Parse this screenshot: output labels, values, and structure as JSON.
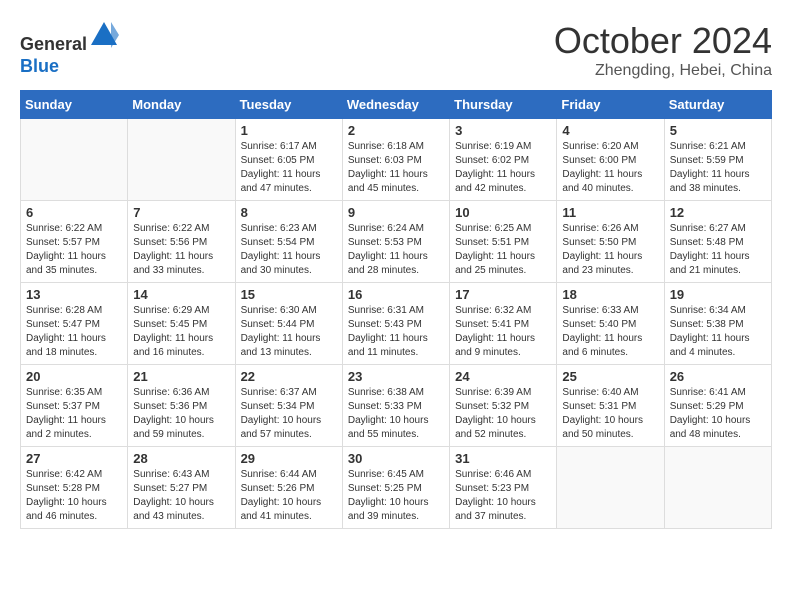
{
  "header": {
    "logo_line1": "General",
    "logo_line2": "Blue",
    "month": "October 2024",
    "location": "Zhengding, Hebei, China"
  },
  "weekdays": [
    "Sunday",
    "Monday",
    "Tuesday",
    "Wednesday",
    "Thursday",
    "Friday",
    "Saturday"
  ],
  "weeks": [
    [
      {
        "day": null,
        "info": null
      },
      {
        "day": null,
        "info": null
      },
      {
        "day": "1",
        "sunrise": "6:17 AM",
        "sunset": "6:05 PM",
        "daylight": "11 hours and 47 minutes."
      },
      {
        "day": "2",
        "sunrise": "6:18 AM",
        "sunset": "6:03 PM",
        "daylight": "11 hours and 45 minutes."
      },
      {
        "day": "3",
        "sunrise": "6:19 AM",
        "sunset": "6:02 PM",
        "daylight": "11 hours and 42 minutes."
      },
      {
        "day": "4",
        "sunrise": "6:20 AM",
        "sunset": "6:00 PM",
        "daylight": "11 hours and 40 minutes."
      },
      {
        "day": "5",
        "sunrise": "6:21 AM",
        "sunset": "5:59 PM",
        "daylight": "11 hours and 38 minutes."
      }
    ],
    [
      {
        "day": "6",
        "sunrise": "6:22 AM",
        "sunset": "5:57 PM",
        "daylight": "11 hours and 35 minutes."
      },
      {
        "day": "7",
        "sunrise": "6:22 AM",
        "sunset": "5:56 PM",
        "daylight": "11 hours and 33 minutes."
      },
      {
        "day": "8",
        "sunrise": "6:23 AM",
        "sunset": "5:54 PM",
        "daylight": "11 hours and 30 minutes."
      },
      {
        "day": "9",
        "sunrise": "6:24 AM",
        "sunset": "5:53 PM",
        "daylight": "11 hours and 28 minutes."
      },
      {
        "day": "10",
        "sunrise": "6:25 AM",
        "sunset": "5:51 PM",
        "daylight": "11 hours and 25 minutes."
      },
      {
        "day": "11",
        "sunrise": "6:26 AM",
        "sunset": "5:50 PM",
        "daylight": "11 hours and 23 minutes."
      },
      {
        "day": "12",
        "sunrise": "6:27 AM",
        "sunset": "5:48 PM",
        "daylight": "11 hours and 21 minutes."
      }
    ],
    [
      {
        "day": "13",
        "sunrise": "6:28 AM",
        "sunset": "5:47 PM",
        "daylight": "11 hours and 18 minutes."
      },
      {
        "day": "14",
        "sunrise": "6:29 AM",
        "sunset": "5:45 PM",
        "daylight": "11 hours and 16 minutes."
      },
      {
        "day": "15",
        "sunrise": "6:30 AM",
        "sunset": "5:44 PM",
        "daylight": "11 hours and 13 minutes."
      },
      {
        "day": "16",
        "sunrise": "6:31 AM",
        "sunset": "5:43 PM",
        "daylight": "11 hours and 11 minutes."
      },
      {
        "day": "17",
        "sunrise": "6:32 AM",
        "sunset": "5:41 PM",
        "daylight": "11 hours and 9 minutes."
      },
      {
        "day": "18",
        "sunrise": "6:33 AM",
        "sunset": "5:40 PM",
        "daylight": "11 hours and 6 minutes."
      },
      {
        "day": "19",
        "sunrise": "6:34 AM",
        "sunset": "5:38 PM",
        "daylight": "11 hours and 4 minutes."
      }
    ],
    [
      {
        "day": "20",
        "sunrise": "6:35 AM",
        "sunset": "5:37 PM",
        "daylight": "11 hours and 2 minutes."
      },
      {
        "day": "21",
        "sunrise": "6:36 AM",
        "sunset": "5:36 PM",
        "daylight": "10 hours and 59 minutes."
      },
      {
        "day": "22",
        "sunrise": "6:37 AM",
        "sunset": "5:34 PM",
        "daylight": "10 hours and 57 minutes."
      },
      {
        "day": "23",
        "sunrise": "6:38 AM",
        "sunset": "5:33 PM",
        "daylight": "10 hours and 55 minutes."
      },
      {
        "day": "24",
        "sunrise": "6:39 AM",
        "sunset": "5:32 PM",
        "daylight": "10 hours and 52 minutes."
      },
      {
        "day": "25",
        "sunrise": "6:40 AM",
        "sunset": "5:31 PM",
        "daylight": "10 hours and 50 minutes."
      },
      {
        "day": "26",
        "sunrise": "6:41 AM",
        "sunset": "5:29 PM",
        "daylight": "10 hours and 48 minutes."
      }
    ],
    [
      {
        "day": "27",
        "sunrise": "6:42 AM",
        "sunset": "5:28 PM",
        "daylight": "10 hours and 46 minutes."
      },
      {
        "day": "28",
        "sunrise": "6:43 AM",
        "sunset": "5:27 PM",
        "daylight": "10 hours and 43 minutes."
      },
      {
        "day": "29",
        "sunrise": "6:44 AM",
        "sunset": "5:26 PM",
        "daylight": "10 hours and 41 minutes."
      },
      {
        "day": "30",
        "sunrise": "6:45 AM",
        "sunset": "5:25 PM",
        "daylight": "10 hours and 39 minutes."
      },
      {
        "day": "31",
        "sunrise": "6:46 AM",
        "sunset": "5:23 PM",
        "daylight": "10 hours and 37 minutes."
      },
      {
        "day": null,
        "info": null
      },
      {
        "day": null,
        "info": null
      }
    ]
  ]
}
